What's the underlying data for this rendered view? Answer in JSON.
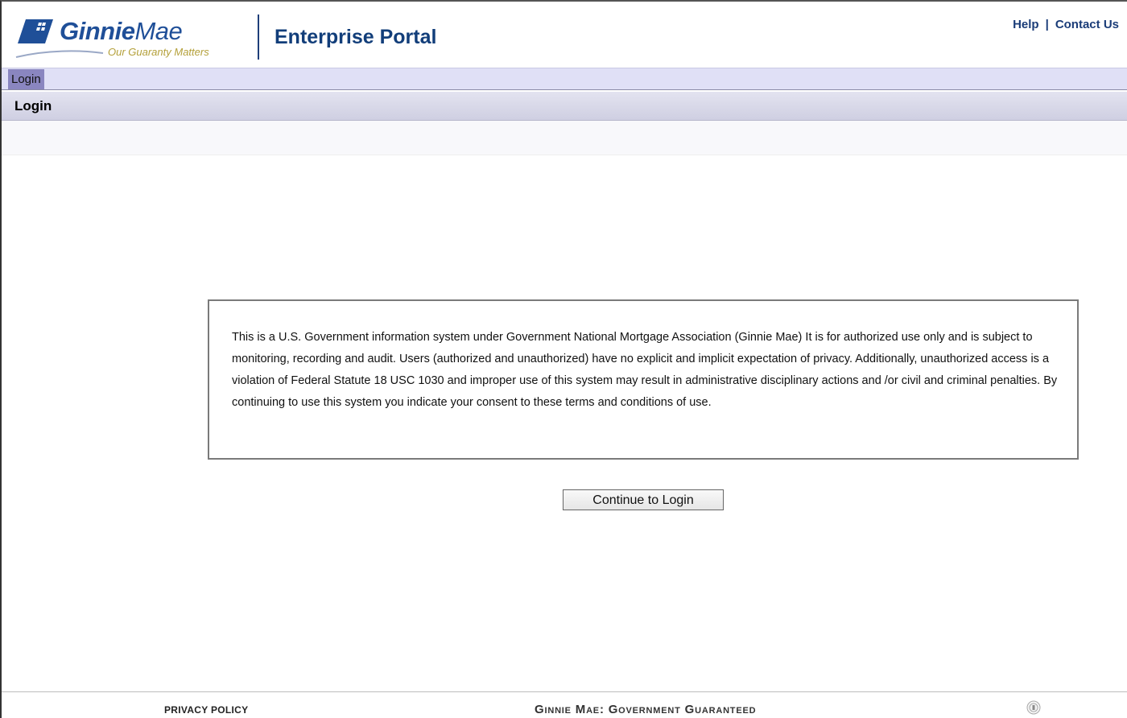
{
  "brand": {
    "name_bold": "Ginnie",
    "name_light": "Mae",
    "tagline": "Our Guaranty Matters",
    "primary_color": "#1f4f98",
    "tagline_color": "#b4a03a"
  },
  "header": {
    "app_title": "Enterprise Portal",
    "links": {
      "help": "Help",
      "separator": "|",
      "contact": "Contact Us"
    }
  },
  "nav": {
    "tabs": [
      {
        "label": "Login",
        "active": true
      }
    ]
  },
  "section": {
    "title": "Login"
  },
  "notice": {
    "text": "This is a U.S. Government information system under Government National Mortgage Association (Ginnie Mae) It is for authorized use only and is subject to monitoring, recording and audit. Users (authorized and unauthorized) have no explicit and implicit expectation of privacy. Additionally, unauthorized access is a violation of Federal Statute 18 USC 1030 and improper use of this system may result in administrative disciplinary actions and /or civil and criminal penalties. By continuing to use this system you indicate your consent to these terms and conditions of use."
  },
  "actions": {
    "continue_label": "Continue to Login"
  },
  "footer": {
    "privacy": "PRIVACY POLICY",
    "slogan": "Ginnie Mae:  Government Guaranteed",
    "seal_icon": "seal-icon"
  }
}
